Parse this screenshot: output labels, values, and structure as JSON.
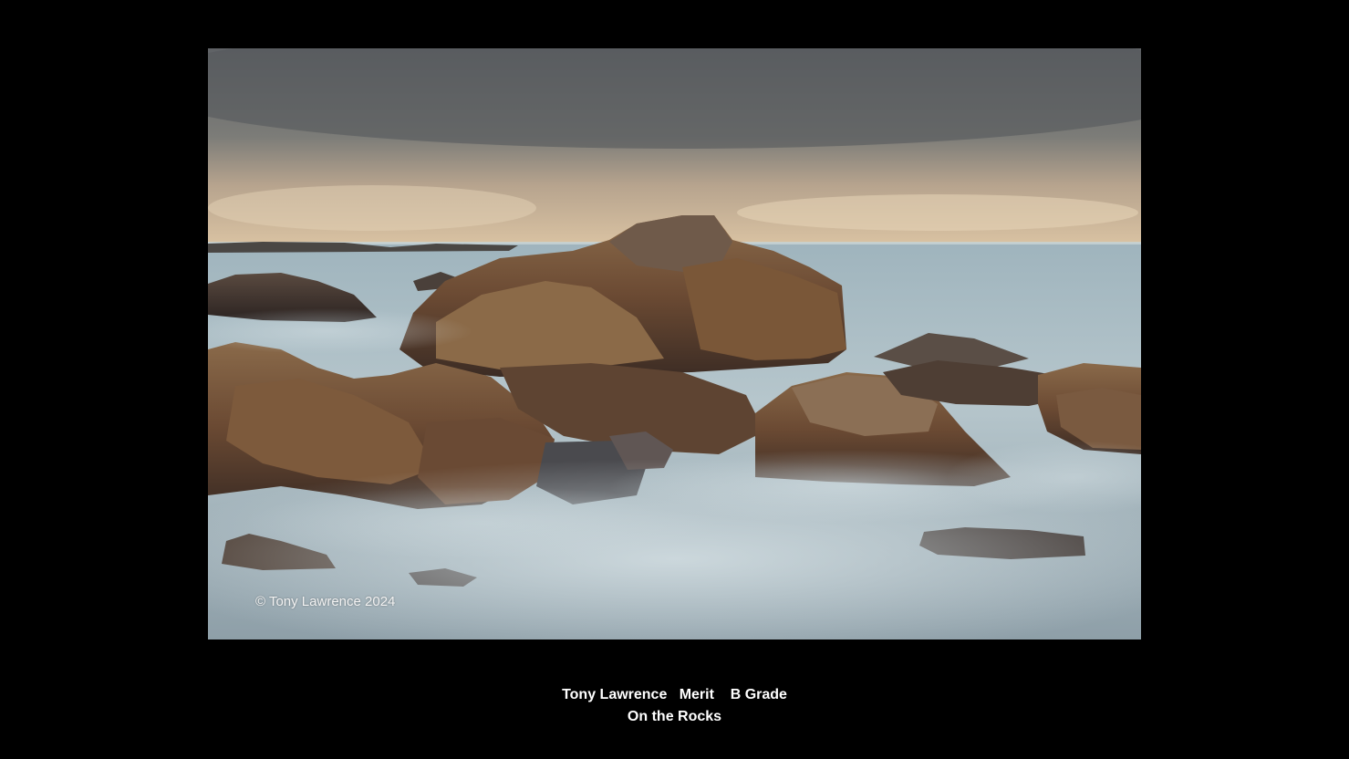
{
  "photo": {
    "watermark": "© Tony Lawrence 2024"
  },
  "caption": {
    "line1": "Tony Lawrence   Merit    B Grade",
    "line2": "On the Rocks"
  },
  "colors": {
    "background": "#000000",
    "caption_text": "#ffffff"
  }
}
